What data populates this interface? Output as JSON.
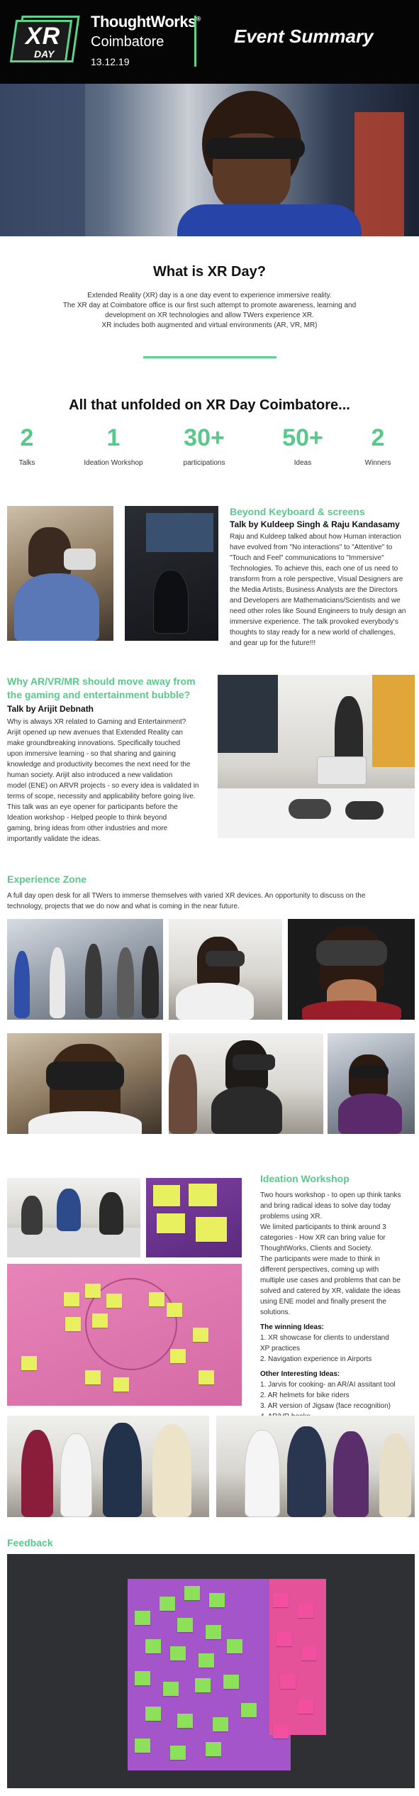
{
  "header": {
    "logo_xr": "XR",
    "logo_day": "DAY",
    "brand": "ThoughtWorks",
    "brand_mark": "®",
    "city": "Coimbatore",
    "date": "13.12.19",
    "title": "Event Summary"
  },
  "intro": {
    "heading": "What is XR Day?",
    "lines": [
      "Extended Reality (XR) day is a one day event to experience immersive reality.",
      "The XR day at Coimbatore office is our first such attempt to promote awareness, learning and",
      "development on XR technologies and allow TWers experience XR.",
      "XR includes both augmented and virtual environments (AR, VR, MR)"
    ]
  },
  "stats": {
    "heading": "All that unfolded on XR Day Coimbatore...",
    "items": [
      {
        "value": "2",
        "label": "Talks"
      },
      {
        "value": "1",
        "label": "Ideation Workshop"
      },
      {
        "value": "30+",
        "label": "participations"
      },
      {
        "value": "50+",
        "label": "Ideas"
      },
      {
        "value": "2",
        "label": "Winners"
      }
    ]
  },
  "talk1": {
    "title": "Beyond Keyboard & screens",
    "speaker": "Talk by Kuldeep Singh & Raju Kandasamy",
    "lines": [
      "Raju and Kuldeep talked about how Human interaction",
      "have evolved from \"No interactions\" to \"Attentive\" to",
      "\"Touch and Feel\" communications to \"Immersive\"",
      "Technologies. To achieve this, each one of us need to",
      "transform from a role perspective, Visual Designers are",
      "the Media Artists, Business Analysts are the Directors",
      "and Developers are Mathematicians/Scientists and we",
      "need other roles like Sound Engineers to truly design an",
      "immersive experience. The talk provoked everybody's",
      "thoughts to stay ready for a new world of challenges,",
      "and gear up for the future!!!"
    ]
  },
  "talk2": {
    "title_line1": "Why AR/VR/MR should move away from",
    "title_line2": "the gaming and entertainment bubble?",
    "speaker": "Talk by Arijit Debnath",
    "lines": [
      "Why is always XR related to Gaming and Entertainment?",
      "Arijit opened up new avenues that Extended Reality can",
      "make groundbreaking innovations. Specifically touched",
      "upon immersive learning - so that sharing and gaining",
      "knowledge and productivity becomes the next need for the",
      "human society. Arijit also introduced a new validation",
      "model (ENE) on ARVR projects - so every idea is validated in",
      "terms of scope, necessity and applicability before going live.",
      "This talk was an eye opener for participants before the",
      "Ideation workshop - Helped people to think beyond",
      "gaming, bring ideas from other industries and more",
      "importantly validate the ideas."
    ]
  },
  "experience": {
    "title": "Experience Zone",
    "line1": "A full day open desk for all TWers to immerse themselves with varied XR devices. An opportunity to discuss on the",
    "line2": "technology, projects that we do now and what is coming in the near future."
  },
  "ideation": {
    "title": "Ideation Workshop",
    "lines": [
      "Two hours workshop - to open up think tanks",
      "and bring radical ideas to solve day today",
      "problems using XR.",
      "We limited participants to think around 3",
      "categories - How XR can bring value for",
      "ThoughtWorks, Clients and Society.",
      "The participants were made to think in",
      "different perspectives, coming up with",
      "multiple use cases and problems that can be",
      "solved and catered by XR, validate the ideas",
      "using ENE model and finally present the",
      "solutions."
    ],
    "winning_title": "The winning Ideas:",
    "winning": [
      "1. XR showcase for clients to understand",
      "XP practices",
      "2. Navigation experience in Airports"
    ],
    "other_title": "Other Interesting Ideas:",
    "other": [
      "1. Jarvis for cooking- an AR/AI assitant tool",
      "2. AR helmets for bike riders",
      "3. AR version of Jigsaw (face recognition)",
      "4. AR/VR books"
    ]
  },
  "feedback": {
    "title": "Feedback"
  },
  "colors": {
    "accent_green": "#58c98a",
    "header_bg": "#050505"
  }
}
